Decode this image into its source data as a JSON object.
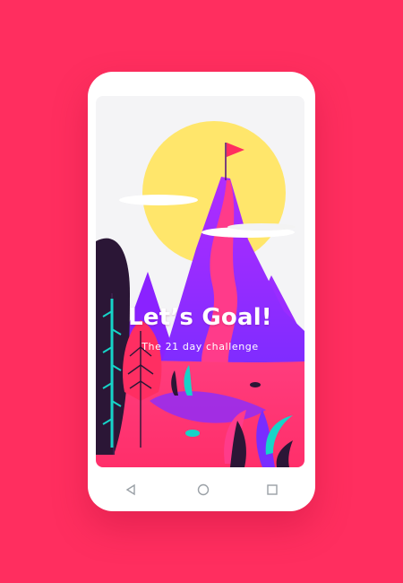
{
  "app": {
    "headline": "Let’s Goal!",
    "subtitle": "The 21 day challenge"
  },
  "navigation": {
    "back": "back-icon",
    "home": "home-icon",
    "recents": "recents-icon"
  },
  "colors": {
    "background": "#ff2e5f",
    "sun": "#ffe66b",
    "mountain": "#8b2cff",
    "path": "#ff3b8a",
    "foliage": "#16d4c8"
  }
}
